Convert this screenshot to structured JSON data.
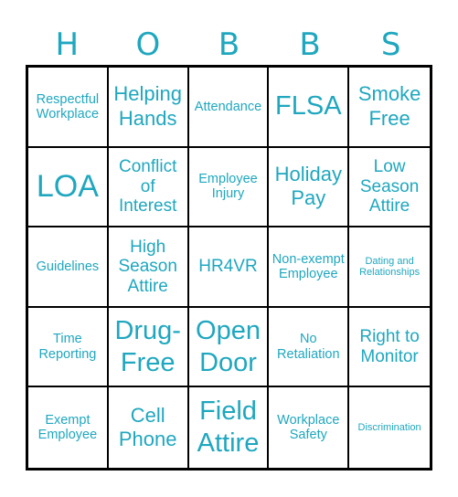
{
  "card": {
    "header": [
      "H",
      "O",
      "B",
      "B",
      "S"
    ],
    "text_color": "#1fa7bf",
    "cells": [
      {
        "text": "Respectful Workplace",
        "size": "sm"
      },
      {
        "text": "Helping Hands",
        "size": "lg"
      },
      {
        "text": "Attendance",
        "size": "sm"
      },
      {
        "text": "FLSA",
        "size": "xl"
      },
      {
        "text": "Smoke Free",
        "size": "lg"
      },
      {
        "text": "LOA",
        "size": "xxl"
      },
      {
        "text": "Conflict of Interest",
        "size": "md"
      },
      {
        "text": "Employee Injury",
        "size": "sm"
      },
      {
        "text": "Holiday Pay",
        "size": "lg"
      },
      {
        "text": "Low Season Attire",
        "size": "md"
      },
      {
        "text": "Guidelines",
        "size": "sm"
      },
      {
        "text": "High Season Attire",
        "size": "md"
      },
      {
        "text": "HR4VR",
        "size": "md"
      },
      {
        "text": "Non-exempt Employee",
        "size": "sm"
      },
      {
        "text": "Dating and Relationships",
        "size": "xs"
      },
      {
        "text": "Time Reporting",
        "size": "sm"
      },
      {
        "text": "Drug-Free",
        "size": "xl"
      },
      {
        "text": "Open Door",
        "size": "xl"
      },
      {
        "text": "No Retaliation",
        "size": "sm"
      },
      {
        "text": "Right to Monitor",
        "size": "md"
      },
      {
        "text": "Exempt Employee",
        "size": "sm"
      },
      {
        "text": "Cell Phone",
        "size": "lg"
      },
      {
        "text": "Field Attire",
        "size": "xl"
      },
      {
        "text": "Workplace Safety",
        "size": "sm"
      },
      {
        "text": "Discrimination",
        "size": "xs"
      }
    ]
  }
}
